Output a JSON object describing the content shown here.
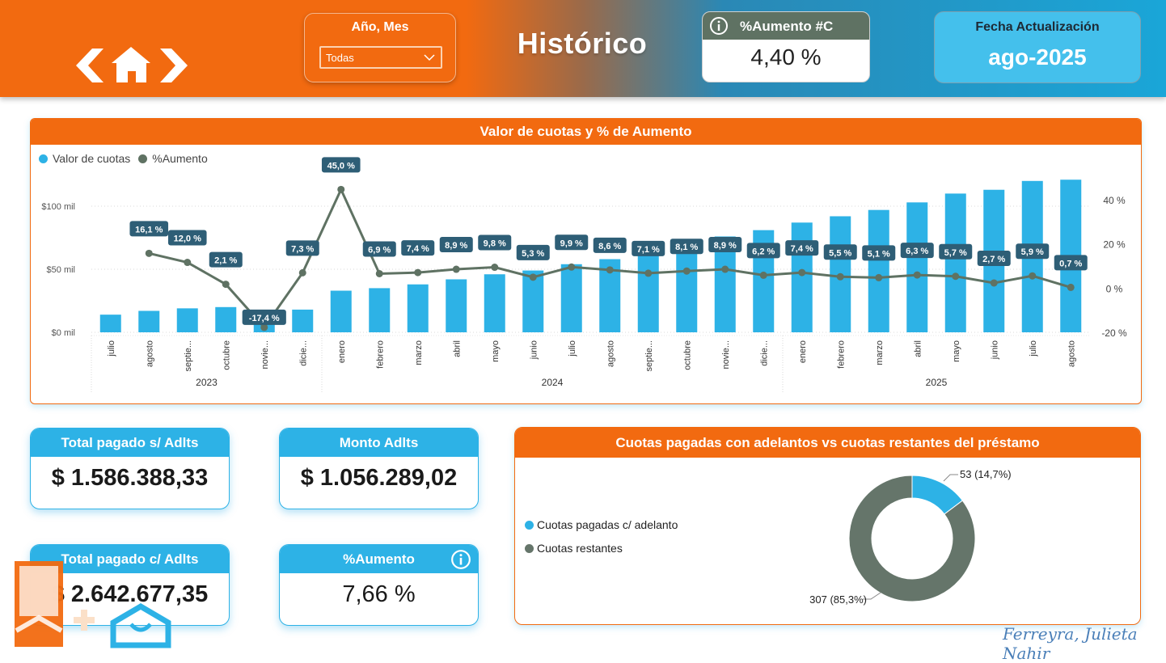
{
  "header": {
    "filter_label": "Año, Mes",
    "filter_value": "Todas",
    "title": "Histórico",
    "kpi_title": "%Aumento #C",
    "kpi_value": "4,40 %",
    "fecha_label": "Fecha Actualización",
    "fecha_value": "ago-2025"
  },
  "chart_panel": {
    "title": "Valor de cuotas y % de Aumento",
    "legend": [
      "Valor de cuotas",
      "%Aumento"
    ]
  },
  "chart_data": {
    "type": "bar",
    "title": "Valor de cuotas y % de Aumento",
    "categories": [
      "julio",
      "agosto",
      "septie...",
      "octubre",
      "novie...",
      "dicie...",
      "enero",
      "febrero",
      "marzo",
      "abril",
      "mayo",
      "junio",
      "julio",
      "agosto",
      "septie...",
      "octubre",
      "novie...",
      "dicie...",
      "enero",
      "febrero",
      "marzo",
      "abril",
      "mayo",
      "junio",
      "julio",
      "agosto"
    ],
    "years": [
      {
        "label": "2023",
        "from": 0,
        "to": 5
      },
      {
        "label": "2024",
        "from": 6,
        "to": 17
      },
      {
        "label": "2025",
        "from": 18,
        "to": 25
      }
    ],
    "series": [
      {
        "name": "Valor de cuotas",
        "axis": "left",
        "values": [
          14,
          17,
          19,
          20,
          13,
          18,
          33,
          35,
          38,
          42,
          46,
          49,
          54,
          58,
          62,
          67,
          76,
          81,
          87,
          92,
          97,
          103,
          110,
          113,
          120,
          121
        ]
      },
      {
        "name": "%Aumento",
        "axis": "right",
        "values": [
          null,
          16.1,
          12.0,
          2.1,
          -17.4,
          7.3,
          45.0,
          6.9,
          7.4,
          8.9,
          9.8,
          5.3,
          9.9,
          8.6,
          7.1,
          8.1,
          8.9,
          6.2,
          7.4,
          5.5,
          5.1,
          6.3,
          5.7,
          2.7,
          5.9,
          0.7
        ],
        "labels": [
          null,
          "16,1 %",
          "12,0 %",
          "2,1 %",
          "-17,4 %",
          "7,3 %",
          "45,0 %",
          "6,9 %",
          "7,4 %",
          "8,9 %",
          "9,8 %",
          "5,3 %",
          "9,9 %",
          "8,6 %",
          "7,1 %",
          "8,1 %",
          "8,9 %",
          "6,2 %",
          "7,4 %",
          "5,5 %",
          "5,1 %",
          "6,3 %",
          "5,7 %",
          "2,7 %",
          "5,9 %",
          "0,7 %"
        ]
      }
    ],
    "ylim_left": [
      0,
      100
    ],
    "yticks_left": [
      "$0 mil",
      "$50 mil",
      "$100 mil"
    ],
    "ylim_right": [
      -20,
      40
    ],
    "yticks_right": [
      "-20 %",
      "0 %",
      "20 %",
      "40 %"
    ],
    "colors": {
      "bars": "#2db2e6",
      "line": "#5f7263"
    }
  },
  "kpis": {
    "total_s_label": "Total pagado s/ Adlts",
    "total_s_value": "$ 1.586.388,33",
    "monto_label": "Monto Adlts",
    "monto_value": "$ 1.056.289,02",
    "total_c_label": "Total pagado c/ Adlts",
    "total_c_value": "$ 2.642.677,35",
    "aumento_label": "%Aumento",
    "aumento_value": "7,66 %"
  },
  "donut": {
    "title": "Cuotas pagadas con adelantos vs cuotas restantes del préstamo",
    "legend": [
      "Cuotas pagadas c/ adelanto",
      "Cuotas restantes"
    ],
    "labels": [
      "53 (14,7%)",
      "307 (85,3%)"
    ],
    "values": [
      53,
      307
    ],
    "colors": [
      "#2db2e6",
      "#65756a"
    ]
  },
  "signature": "Ferreyra, Julieta Nahir"
}
